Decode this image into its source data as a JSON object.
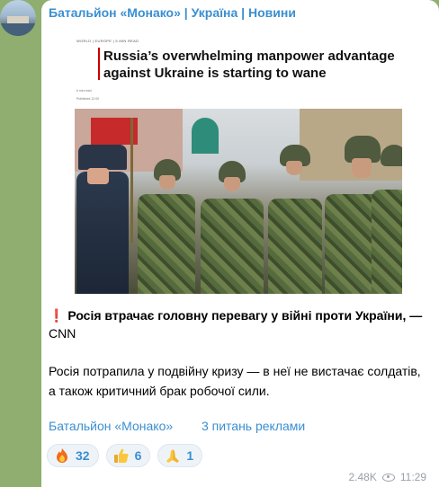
{
  "channel": {
    "name": "Батальйон «Монако» | Україна | Новини"
  },
  "article": {
    "crumbs": "WORLD  |  EUROPE  |  5 MIN READ",
    "headline": "Russia’s overwhelming manpower advantage against Ukraine is starting to wane",
    "byline": "6 min read",
    "dateline": "Published 12:00"
  },
  "message": {
    "line1_prefix": "❗",
    "line1": "Росія втрачає головну перевагу у війні проти України, —",
    "line1_cont": "CNN",
    "para2_line1": "Росія потрапила у подвійну кризу — в неї не вистачає солдатів,",
    "para2_line2": "а також критичний брак робочої сили."
  },
  "links": {
    "channel": "Батальйон «Монако»",
    "ads": "3 питань реклами"
  },
  "reactions": [
    {
      "icon": "fire-icon",
      "count": "32"
    },
    {
      "icon": "thumbs-up-icon",
      "count": "6"
    },
    {
      "icon": "praying-hands-icon",
      "count": "1"
    }
  ],
  "meta": {
    "views": "2.48K",
    "time": "11:29"
  },
  "colors": {
    "accent": "#3a8fd1",
    "background": "#8fae6f",
    "headline_bar": "#cc0000"
  }
}
